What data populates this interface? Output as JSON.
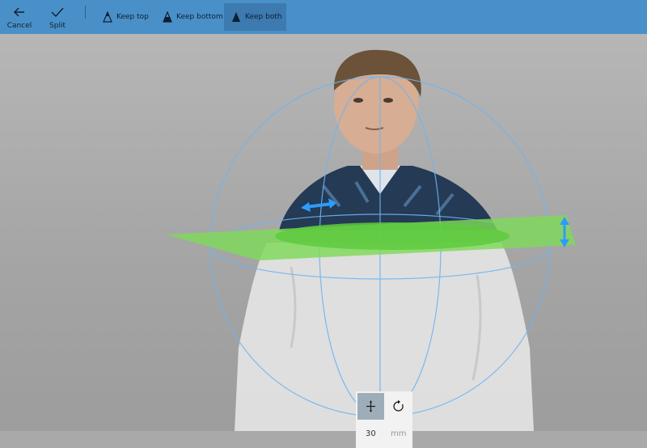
{
  "toolbar": {
    "cancel_label": "Cancel",
    "split_label": "Split",
    "keep_top_label": "Keep top",
    "keep_bottom_label": "Keep bottom",
    "keep_both_label": "Keep both",
    "selected_option": "Keep both",
    "icons": [
      "back-arrow-icon",
      "checkmark-icon",
      "keep-top-icon",
      "keep-bottom-icon",
      "keep-both-icon"
    ]
  },
  "panel": {
    "offset_value": "30",
    "unit": "mm",
    "mode": "move",
    "icons": [
      "move-icon",
      "rotate-icon"
    ]
  },
  "colors": {
    "toolbar": "#4a90c8",
    "plane": "#7fd95a",
    "gizmo": "#6fb4f0",
    "arrow": "#2d9cff"
  }
}
